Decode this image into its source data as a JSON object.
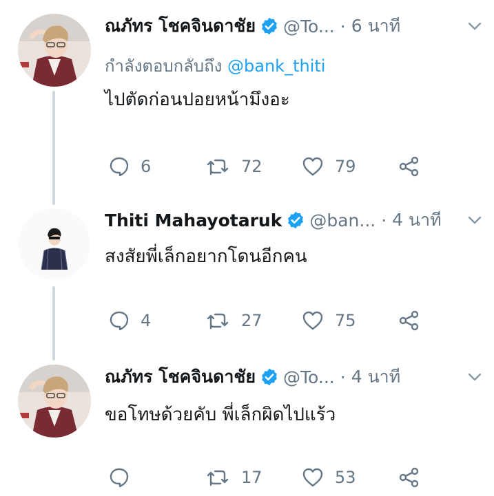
{
  "tweets": [
    {
      "name": "ณภัทร โชคจินดาชัย",
      "handle": "@To...",
      "separator": "·",
      "time": "6 นาที",
      "replying_prefix": "กำลังตอบกลับถึง",
      "replying_to": "@bank_thiti",
      "text": "ไปตัดก่อนปอยหน้ามึงอะ",
      "replies": "6",
      "retweets": "72",
      "likes": "79"
    },
    {
      "name": "Thiti Mahayotaruk",
      "handle": "@ban...",
      "separator": "·",
      "time": "4 นาที",
      "text": "สงสัยพี่เล็กอยากโดนอีกคน",
      "replies": "4",
      "retweets": "27",
      "likes": "75"
    },
    {
      "name": "ณภัทร โชคจินดาชัย",
      "handle": "@To...",
      "separator": "·",
      "time": "4 นาที",
      "text": "ขอโทษด้วยคับ พี่เล็กผิดไปแร้ว",
      "replies": "",
      "retweets": "17",
      "likes": "53"
    }
  ],
  "icons": {
    "verified": "verified-badge-icon",
    "reply": "reply-icon",
    "retweet": "retweet-icon",
    "like": "heart-icon",
    "share": "share-icon",
    "menu": "chevron-down-icon"
  },
  "colors": {
    "text": "#14171a",
    "secondary": "#657786",
    "link": "#1da1f2",
    "verified": "#1da1f2",
    "thread_line": "#cfd9de"
  }
}
